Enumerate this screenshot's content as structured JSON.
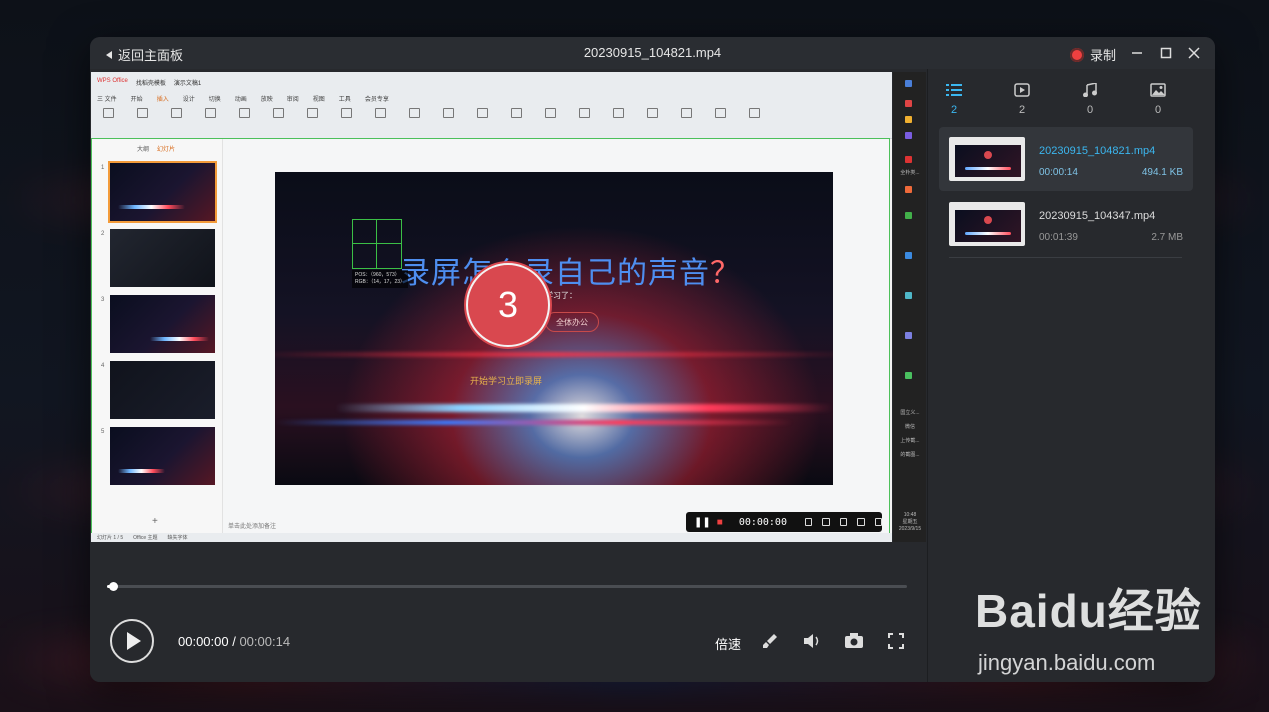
{
  "window": {
    "back_label": "返回主面板",
    "title": "20230915_104821.mp4",
    "record_label": "录制"
  },
  "video_frame": {
    "wps_tabs": [
      "WPS Office",
      "找稻壳模板",
      "演示文稿1"
    ],
    "wps_menu": [
      "三 文件",
      "开始",
      "插入",
      "设计",
      "切换",
      "动画",
      "放映",
      "审阅",
      "视图",
      "工具",
      "会员专享"
    ],
    "thumb_header": [
      "大纲",
      "幻灯片"
    ],
    "thumb_numbers": [
      "1",
      "2",
      "3",
      "4",
      "5"
    ],
    "slide_title": "录屏怎么录自己的声音",
    "slide_title_q": "？",
    "slide_subtitle": "你学习了：",
    "slide_pill": "全体办公",
    "slide_bottom": "开始学习立即录屏",
    "pos_info": "POS：（960，573）\nRGB：（14，17，23）",
    "countdown": "3",
    "notes": "单击此处添加备注",
    "status_items": [
      "幻灯片 1 / 5",
      "Office 主题",
      "缺失字体"
    ],
    "rec_time": "00:00:00",
    "taskbar_texts": [
      "全朴类...",
      "国立义...",
      "微信",
      "上传截...",
      "的截图..."
    ],
    "taskbar_clock": "10:48\n星期五\n2023/9/15"
  },
  "player": {
    "progress_fraction": 0.008,
    "current_time": "00:00:00",
    "separator": " / ",
    "total_time": "00:00:14",
    "speed_label": "倍速"
  },
  "sidebar": {
    "tabs": [
      {
        "icon": "list-icon",
        "count": "2"
      },
      {
        "icon": "video-icon",
        "count": "2"
      },
      {
        "icon": "music-icon",
        "count": "0"
      },
      {
        "icon": "image-icon",
        "count": "0"
      }
    ],
    "files": [
      {
        "name": "20230915_104821.mp4",
        "duration": "00:00:14",
        "size": "494.1 KB"
      },
      {
        "name": "20230915_104347.mp4",
        "duration": "00:01:39",
        "size": "2.7 MB"
      }
    ]
  },
  "watermark": {
    "brand": "Baidu经验",
    "url": "jingyan.baidu.com"
  },
  "colors": {
    "accent": "#3bb7f0",
    "record": "#ef4040",
    "countdown": "#d9484f"
  }
}
